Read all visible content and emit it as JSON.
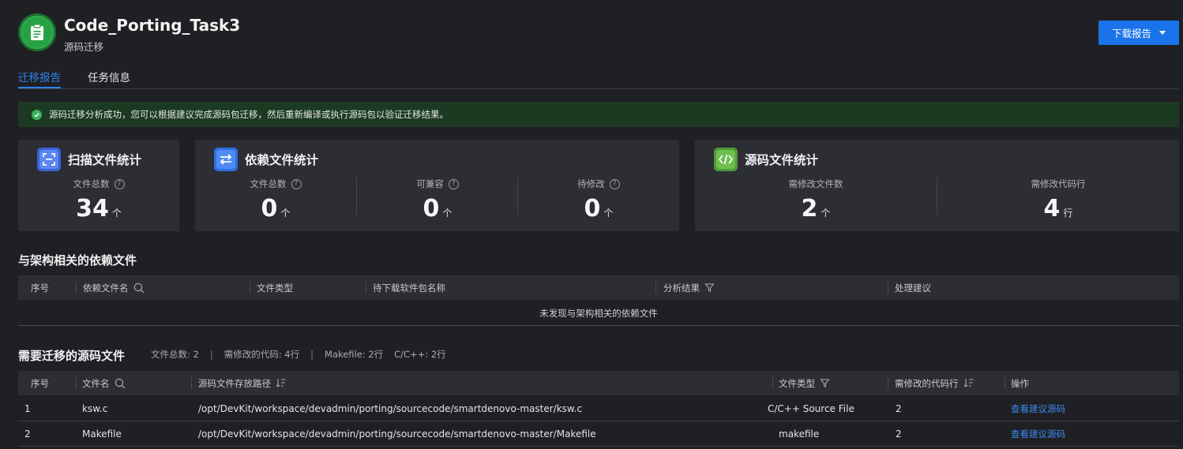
{
  "header": {
    "title": "Code_Porting_Task3",
    "subtitle": "源码迁移",
    "download_label": "下载报告"
  },
  "tabs": [
    {
      "label": "迁移报告",
      "active": true
    },
    {
      "label": "任务信息",
      "active": false
    }
  ],
  "alert": {
    "text": "源码迁移分析成功，您可以根据建议完成源码包迁移，然后重新编译或执行源码包以验证迁移结果。"
  },
  "scan_card": {
    "title": "扫描文件统计",
    "stats": [
      {
        "label": "文件总数",
        "value": "34",
        "unit": "个"
      }
    ]
  },
  "dep_card": {
    "title": "依赖文件统计",
    "stats": [
      {
        "label": "文件总数",
        "value": "0",
        "unit": "个"
      },
      {
        "label": "可兼容",
        "value": "0",
        "unit": "个"
      },
      {
        "label": "待修改",
        "value": "0",
        "unit": "个"
      }
    ]
  },
  "src_card": {
    "title": "源码文件统计",
    "stats": [
      {
        "label": "需修改文件数",
        "value": "2",
        "unit": "个"
      },
      {
        "label": "需修改代码行",
        "value": "4",
        "unit": "行"
      }
    ]
  },
  "dep_table": {
    "title": "与架构相关的依赖文件",
    "columns": [
      "序号",
      "依赖文件名",
      "文件类型",
      "待下载软件包名称",
      "分析结果",
      "处理建议"
    ],
    "empty_text": "未发现与架构相关的依赖文件"
  },
  "src_table": {
    "title": "需要迁移的源码文件",
    "summary": {
      "total": "文件总数:  2",
      "lines": "需修改的代码: 4行",
      "makefile": "Makefile: 2行",
      "cpp": "C/C++: 2行",
      "separator": "|"
    },
    "columns": [
      "序号",
      "文件名",
      "源码文件存放路径",
      "文件类型",
      "需修改的代码行",
      "操作"
    ],
    "rows": [
      {
        "index": "1",
        "name": "ksw.c",
        "path": "/opt/DevKit/workspace/devadmin/porting/sourcecode/smartdenovo-master/ksw.c",
        "type": "C/C++ Source File",
        "lines": "2",
        "action": "查看建议源码"
      },
      {
        "index": "2",
        "name": "Makefile",
        "path": "/opt/DevKit/workspace/devadmin/porting/sourcecode/smartdenovo-master/Makefile",
        "type": "makefile",
        "lines": "2",
        "action": "查看建议源码"
      }
    ]
  },
  "colors": {
    "accent": "#1a73e8",
    "success": "#38b35b",
    "alert_bg": "#1c3a22",
    "link": "#3b8af5"
  },
  "icons": [
    "clipboard-icon",
    "caret-down-icon",
    "check-circle-icon",
    "scan-icon",
    "swap-icon",
    "code-icon",
    "help-icon",
    "search-icon",
    "filter-icon",
    "sort-icon"
  ]
}
